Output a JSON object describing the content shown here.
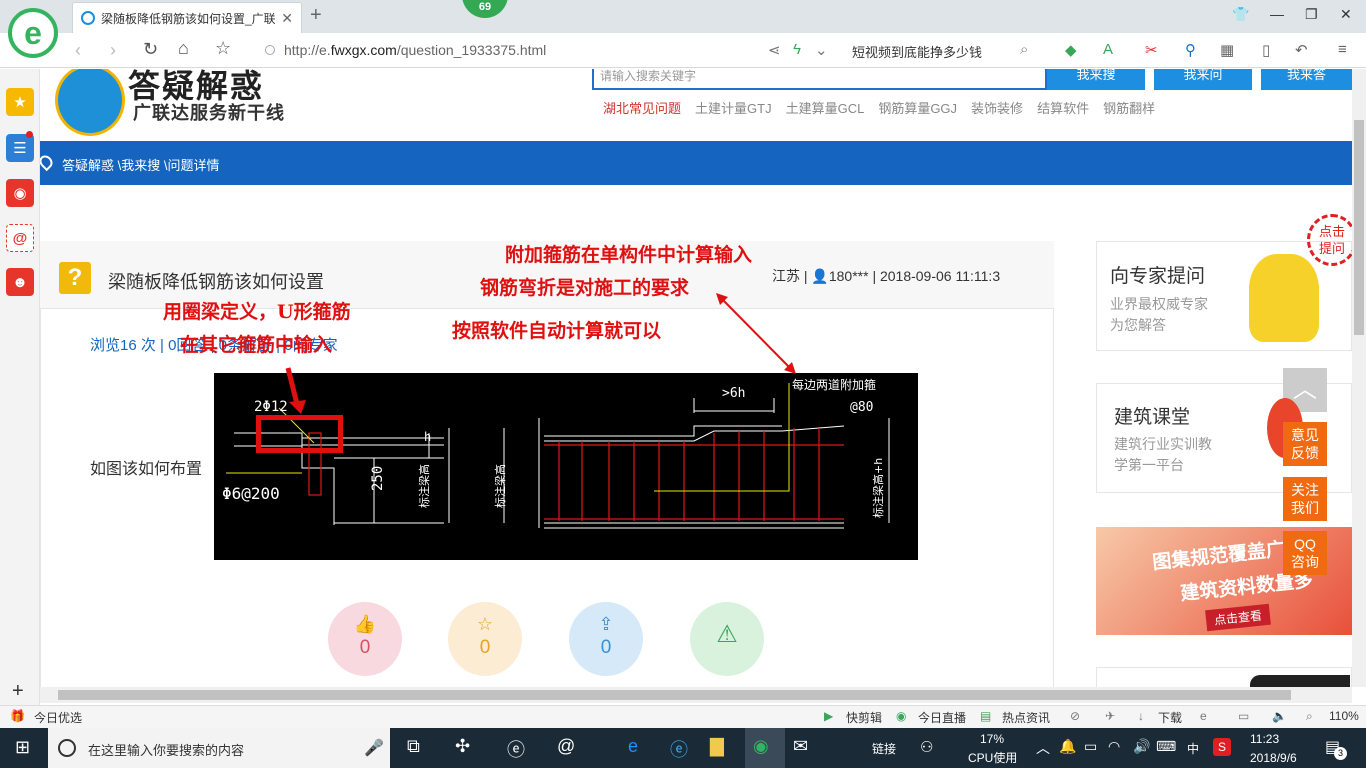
{
  "browser": {
    "tab_title": "梁随板降低钢筋该如何设置_广联",
    "tab_close": "✕",
    "new_tab": "+",
    "badge": "69",
    "url_domain_prefix": "http://e.",
    "url_domain": "fwxgx.com",
    "url_path": "/question_1933375.html",
    "search_query": "短视频到底能挣多少钱"
  },
  "site": {
    "logo_text": "答疑解惑",
    "slogan": "广联达服务新干线",
    "search_placeholder": "请输入搜索关键字",
    "buttons": [
      "我来搜",
      "我来问",
      "我来答"
    ],
    "categories": [
      "湖北常见问题",
      "土建计量GTJ",
      "土建算量GCL",
      "钢筋算量GGJ",
      "装饰装修",
      "结算软件",
      "钢筋翻样"
    ],
    "breadcrumb": "答疑解惑 \\我来搜 \\问题详情"
  },
  "question": {
    "title": "梁随板降低钢筋该如何设置",
    "meta": "江苏 | 👤180*** | 2018-09-06 11:11:3",
    "stats": "浏览16 次 | 0回答 | 0条解答 | 0问专家",
    "body": "如图该如何布置",
    "actions": [
      {
        "name": "like",
        "icon": "👍",
        "count": "0",
        "color": "#d94f62",
        "bg": "#f8d9df"
      },
      {
        "name": "favorite",
        "icon": "☆",
        "count": "0",
        "color": "#e8a326",
        "bg": "#fbecd3"
      },
      {
        "name": "share",
        "icon": "⇪",
        "count": "0",
        "color": "#3a8fd9",
        "bg": "#d5e9f8"
      },
      {
        "name": "report",
        "icon": "⚠",
        "count": "",
        "color": "#3aa65a",
        "bg": "#d9f2de"
      }
    ]
  },
  "cad": {
    "label_2phi": "2Φ12",
    "label_phi6": "Φ6@200",
    "label_250": "250",
    "label_h": "h",
    "label_6h": ">6h",
    "label_addstir": "每边两道附加箍",
    "label_at80": "@80",
    "label_std1": "标注梁高",
    "label_std2": "标注梁高",
    "label_std3": "标注梁高+h"
  },
  "annotations": {
    "a1": "用圈梁定义，U形箍筋",
    "a2": "在其它箍筋中输入",
    "a3": "附加箍筋在单构件中计算输入",
    "a4": "钢筋弯折是对施工的要求",
    "a5": "按照软件自动计算就可以"
  },
  "right": {
    "expert_title": "向专家提问",
    "expert_sub1": "业界最权威专家",
    "expert_sub2": "为您解答",
    "course_title": "建筑课堂",
    "course_sub1": "建筑行业实训教",
    "course_sub2": "学第一平台",
    "banner_line1": "图集规范覆盖广",
    "banner_line2": "建筑资料数量多",
    "banner_btn": "点击查看",
    "click_bubble": "点击\n提问",
    "float_feedback": "意见反馈",
    "float_follow": "关注我们",
    "float_qq": "QQ咨询"
  },
  "statusbar": {
    "left": "今日优选",
    "items": [
      "快剪辑",
      "今日直播",
      "热点资讯",
      "下载"
    ],
    "zoom": "110%"
  },
  "taskbar": {
    "search": "在这里输入你要搜索的内容",
    "link": "链接",
    "cpu_pct": "17%",
    "cpu_label": "CPU使用",
    "ime": "中",
    "time": "11:23",
    "date": "2018/9/6",
    "notif": "3"
  }
}
